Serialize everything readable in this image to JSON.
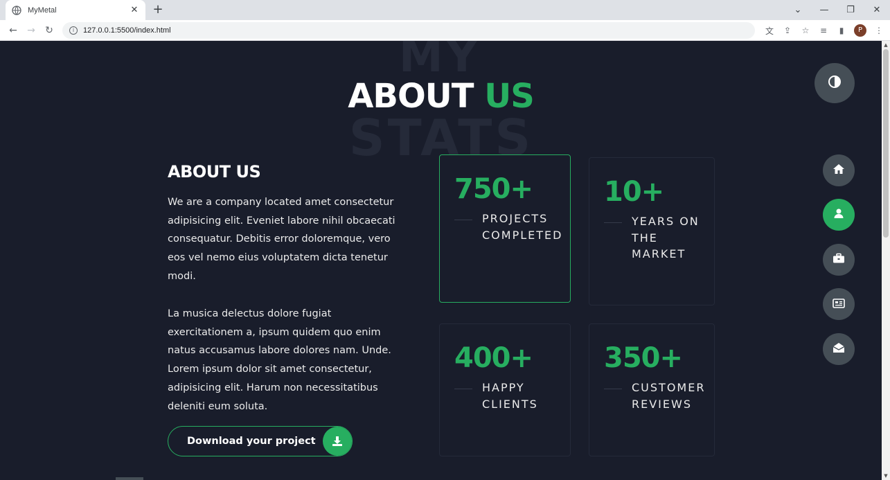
{
  "browser": {
    "tab_title": "MyMetal",
    "url": "127.0.0.1:5500/index.html",
    "profile_initial": "P"
  },
  "page": {
    "bg_word_top": "MY",
    "bg_word_bottom": "STATS",
    "title_part1": "ABOUT",
    "title_part2": "US",
    "about_heading": "ABOUT US",
    "about_p1": "We are a company located amet consectetur adipisicing elit. Eveniet labore nihil obcaecati consequatur. Debitis error doloremque, vero eos vel nemo eius voluptatem dicta tenetur modi.",
    "about_p2": "La musica delectus dolore fugiat exercitationem a, ipsum quidem quo enim natus accusamus labore dolores nam. Unde. Lorem ipsum dolor sit amet consectetur, adipisicing elit. Harum non necessitatibus deleniti eum soluta.",
    "download_label": "Download your project"
  },
  "stats": [
    {
      "number": "750+",
      "label_line1": "PROJECTS",
      "label_line2": "COMPLETED",
      "label_line3": ""
    },
    {
      "number": "10+",
      "label_line1": "YEARS ON",
      "label_line2": "THE",
      "label_line3": "MARKET"
    },
    {
      "number": "400+",
      "label_line1": "HAPPY",
      "label_line2": "CLIENTS",
      "label_line3": ""
    },
    {
      "number": "350+",
      "label_line1": "CUSTOMER",
      "label_line2": "REVIEWS",
      "label_line3": ""
    }
  ],
  "nav_icons": [
    "home-icon",
    "user-icon",
    "briefcase-icon",
    "newspaper-icon",
    "envelope-open-icon"
  ],
  "colors": {
    "accent": "#27ae60",
    "background": "#191d2b",
    "control": "#454e56"
  }
}
